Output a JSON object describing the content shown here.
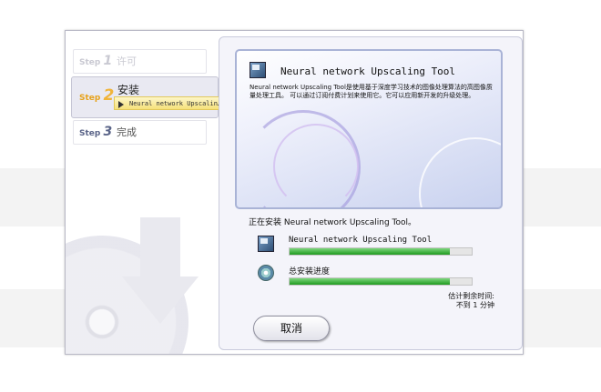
{
  "steps": [
    {
      "num": "1",
      "prefix": "Step",
      "label": "许可",
      "state": "pending"
    },
    {
      "num": "2",
      "prefix": "Step",
      "label": "安装",
      "state": "active"
    },
    {
      "num": "3",
      "prefix": "Step",
      "label": "完成",
      "state": "pending-dark"
    }
  ],
  "substep": "Neural network Upscalin…",
  "banner": {
    "title": "Neural network Upscaling Tool",
    "description": "Neural network Upscaling Tool是使用基于深度学习技术的图像处理算法的高图像质量处理工具。 可以通过订阅付费计划来使用它。它可以应用新开发的升级处理。"
  },
  "status_text": "正在安装 Neural network Upscaling Tool。",
  "progress": [
    {
      "label": "Neural network Upscaling Tool",
      "percent": 88,
      "icon": "app-icon"
    },
    {
      "label": "总安装进度",
      "percent": 88,
      "icon": "disk-icon"
    }
  ],
  "estimate": {
    "label": "估计剩余时间:",
    "value": "不到 1 分钟"
  },
  "cancel_label": "取消",
  "colors": {
    "accent": "#f0b43a",
    "progress_green": "#1e9a1e",
    "banner_border": "#a9b3d6"
  }
}
